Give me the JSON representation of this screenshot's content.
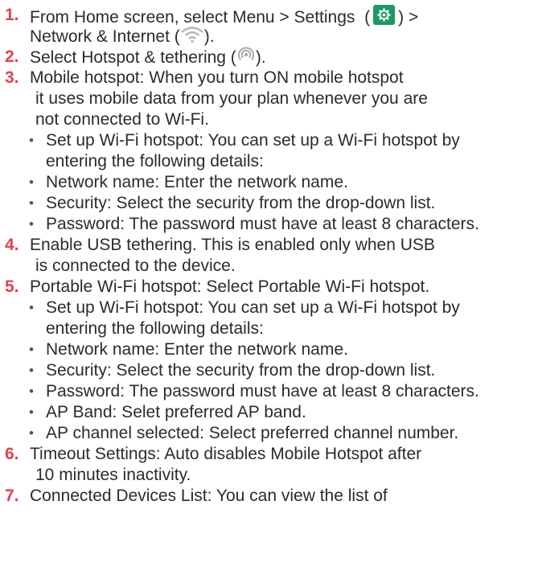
{
  "steps": [
    {
      "num": "1.",
      "pre": "From Home screen, select Menu > Settings  (",
      "post": ") >",
      "cont": "Network & Internet (",
      "cont_post": ")."
    },
    {
      "num": "2.",
      "pre": "Select Hotspot & tethering (",
      "post": ")."
    },
    {
      "num": "3.",
      "lines": [
        "Mobile hotspot: When you turn ON mobile hotspot",
        "it uses mobile data from your plan whenever you are",
        "not connected to Wi-Fi."
      ]
    },
    {
      "num": "4.",
      "lines": [
        "Enable USB tethering. This is enabled only when USB",
        "is connected to the device."
      ]
    },
    {
      "num": "5.",
      "lines": [
        "Portable Wi-Fi hotspot: Select Portable Wi-Fi hotspot."
      ]
    },
    {
      "num": "6.",
      "lines": [
        "Timeout Settings: Auto disables Mobile Hotspot after",
        "10 minutes inactivity."
      ]
    },
    {
      "num": "7.",
      "lines": [
        "Connected Devices List: You can view the list of"
      ]
    }
  ],
  "bullets3": [
    [
      "Set up Wi-Fi hotspot: You can set up a Wi-Fi hotspot by",
      "entering the following details:"
    ],
    [
      "Network name: Enter the network name."
    ],
    [
      "Security: Select the security from the drop-down list."
    ],
    [
      "Password: The password must have at least 8 characters."
    ]
  ],
  "bullets5": [
    [
      "Set up Wi-Fi hotspot: You can set up a Wi-Fi hotspot by",
      "entering the following details:"
    ],
    [
      "Network name: Enter the network name."
    ],
    [
      "Security: Select the security from the drop-down list."
    ],
    [
      "Password: The password must have at least 8 characters."
    ],
    [
      "AP Band: Selet preferred AP band."
    ],
    [
      "AP channel selected:  Select preferred channel number."
    ]
  ],
  "bullet_char": "•",
  "icons": {
    "settings": "gear-icon",
    "network": "wifi-icon",
    "hotspot": "hotspot-icon"
  },
  "colors": {
    "number": "#e3414f",
    "settings_icon_bg": "#1b9a62",
    "text": "#2b2b2b"
  }
}
